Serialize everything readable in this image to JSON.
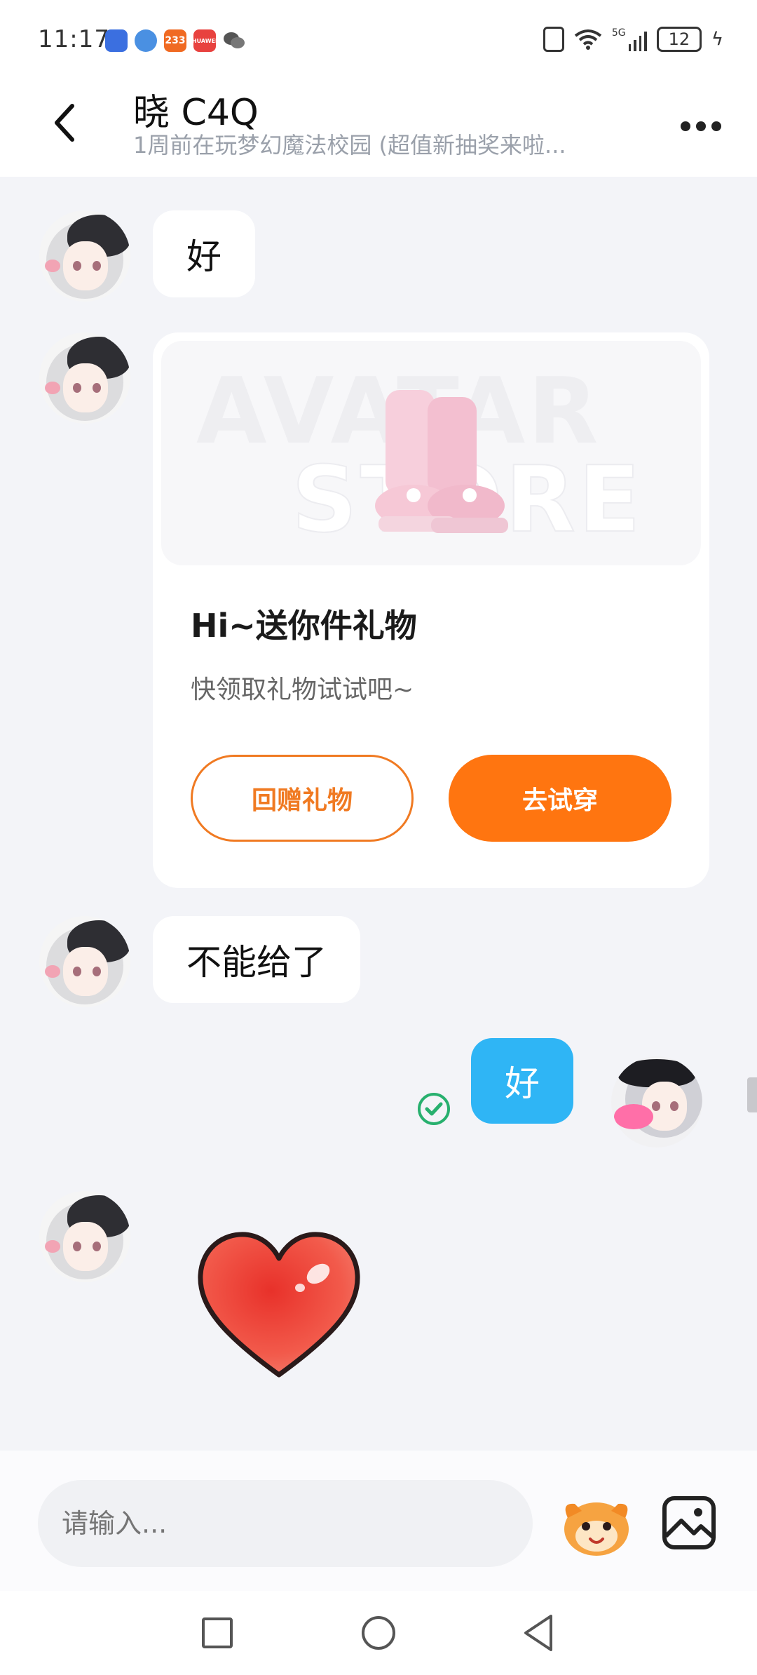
{
  "status_bar": {
    "time": "11:17",
    "app_icons": [
      {
        "name": "doc-app-icon",
        "color": "#3b6fe0",
        "label": ""
      },
      {
        "name": "browser-app-icon",
        "color": "#4a90e2",
        "label": ""
      },
      {
        "name": "233-app-icon",
        "color": "#f06a22",
        "label": "233"
      },
      {
        "name": "huawei-app-icon",
        "color": "#e8423f",
        "label": "HUAWEI"
      },
      {
        "name": "wechat-icon",
        "color": "#555555",
        "label": ""
      }
    ],
    "network": "5G",
    "battery": "12"
  },
  "header": {
    "title": "晓  C4Q",
    "subtitle": "1周前在玩梦幻魔法校园 (超值新抽奖来啦..."
  },
  "messages": [
    {
      "text": "好"
    },
    {
      "text": "不能给了"
    },
    {
      "text": "好"
    }
  ],
  "gift_card": {
    "watermark_top": "AVATAR",
    "watermark_bottom": "STORE",
    "title": "Hi~送你件礼物",
    "desc": "快领取礼物试试吧~",
    "return_label": "回赠礼物",
    "try_label": "去试穿"
  },
  "input": {
    "placeholder": "请输入..."
  },
  "colors": {
    "accent_orange": "#ff7510",
    "bubble_blue": "#2fb5f5",
    "read_green": "#27b06e"
  }
}
